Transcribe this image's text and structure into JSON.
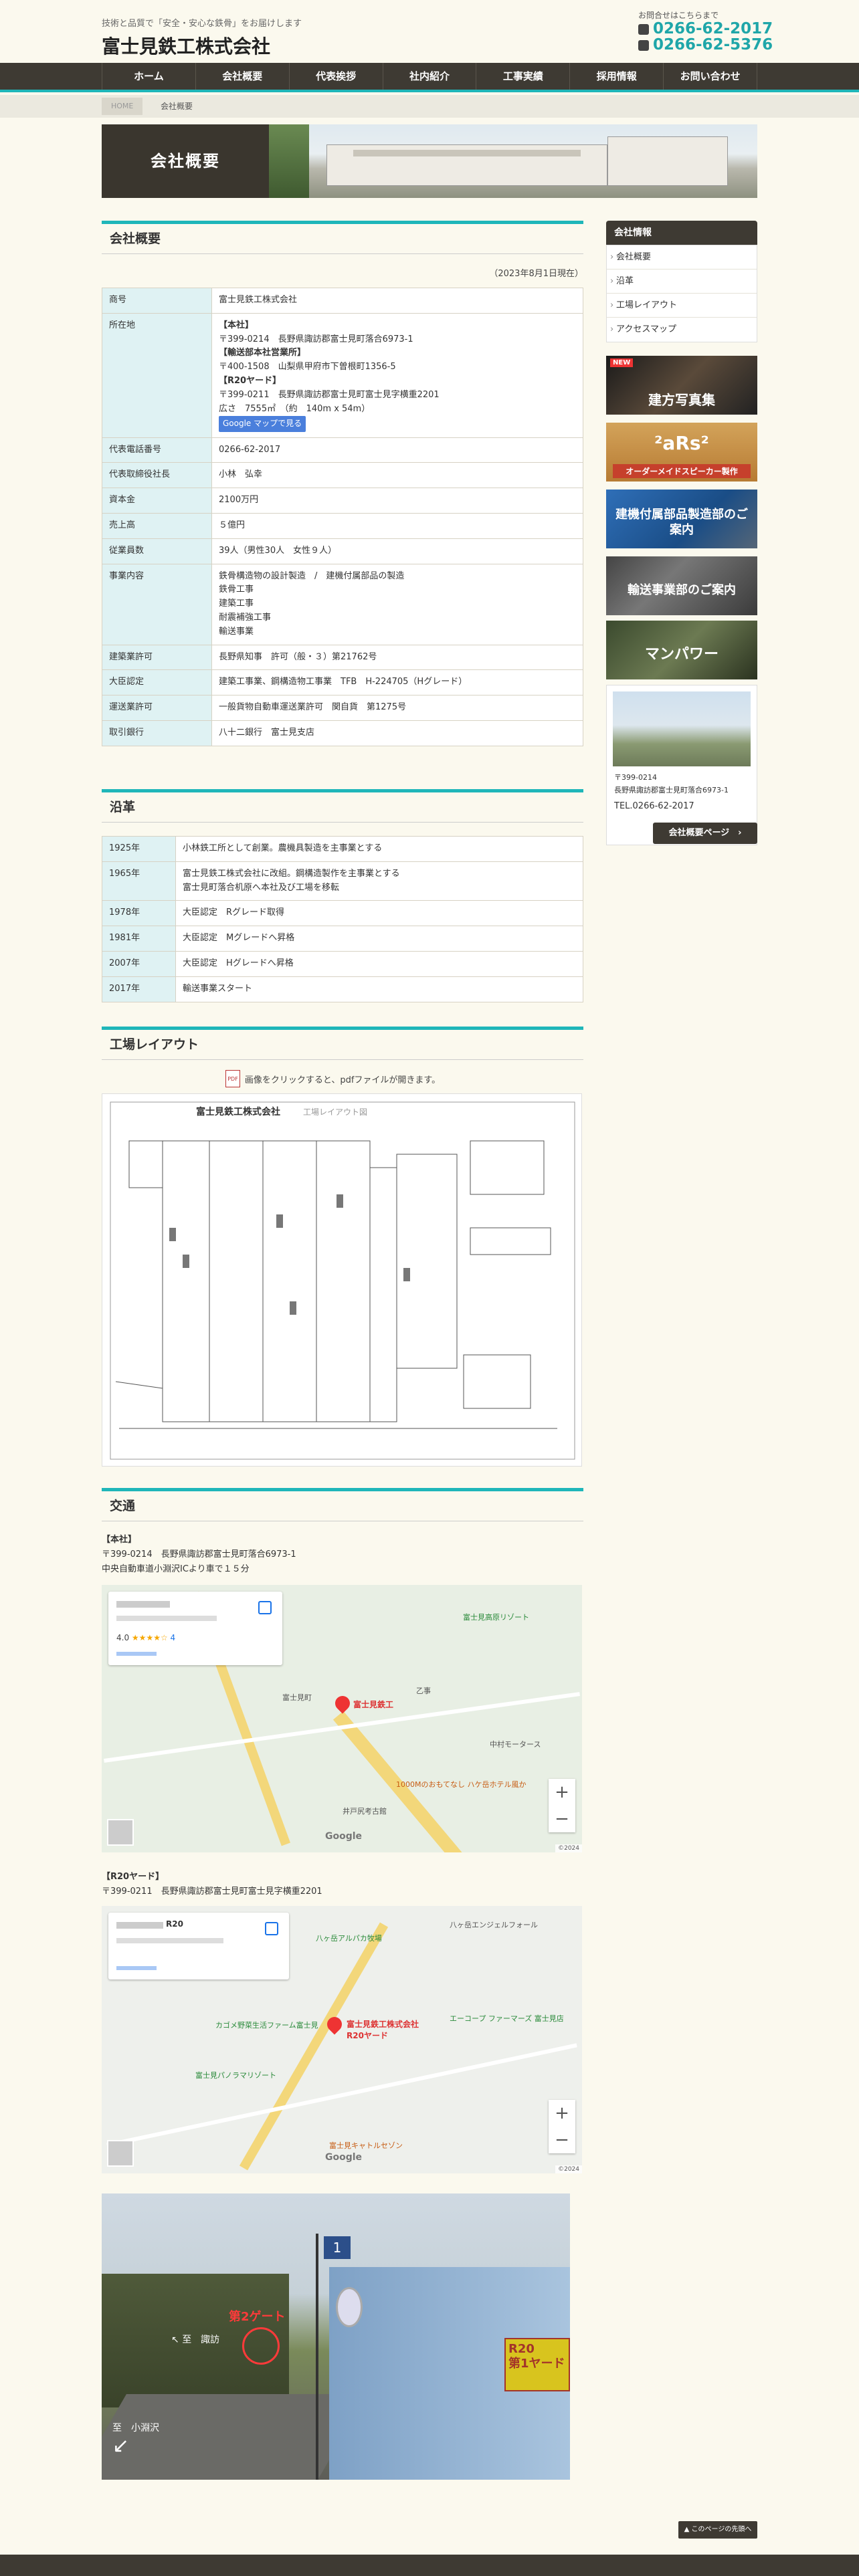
{
  "header": {
    "tagline": "技術と品質で「安全・安心な鉄骨」をお届けします",
    "site_title": "富士見鉄工株式会社",
    "contact_label": "お問合せはこちらまで",
    "tel1": "0266-62-2017",
    "tel2": "0266-62-5376"
  },
  "nav": [
    "ホーム",
    "会社概要",
    "代表挨拶",
    "社内紹介",
    "工事実績",
    "採用情報",
    "お問い合わせ"
  ],
  "breadcrumb": {
    "home": "HOME",
    "current": "会社概要"
  },
  "page_title": "会社概要",
  "overview": {
    "heading": "会社概要",
    "as_of": "（2023年8月1日現在）",
    "rows": [
      {
        "label": "商号",
        "value": "富士見鉄工株式会社"
      },
      {
        "label": "所在地",
        "lines": [
          "【本社】",
          "〒399-0214　長野県諏訪郡富士見町落合6973-1",
          "【輸送部本社営業所】",
          "〒400-1508　山梨県甲府市下曽根町1356-5",
          "【R20ヤード】",
          "〒399-0211　長野県諏訪郡富士見町富士見字横重2201",
          "広さ　7555㎡　（約　140m x 54m）"
        ],
        "button": "Google マップで見る"
      },
      {
        "label": "代表電話番号",
        "value": "0266-62-2017"
      },
      {
        "label": "代表取締役社長",
        "value": "小林　弘幸"
      },
      {
        "label": "資本金",
        "value": "2100万円"
      },
      {
        "label": "売上高",
        "value": "５億円"
      },
      {
        "label": "従業員数",
        "value": "39人（男性30人　女性９人）"
      },
      {
        "label": "事業内容",
        "lines": [
          "鉄骨構造物の設計製造　/　建機付属部品の製造",
          "鉄骨工事",
          "建築工事",
          "耐震補強工事",
          "輸送事業"
        ]
      },
      {
        "label": "建築業許可",
        "value": "長野県知事　許可（般・３）第21762号"
      },
      {
        "label": "大臣認定",
        "value": "建築工事業、鋼構造物工事業　TFB　H-224705（Hグレード）"
      },
      {
        "label": "運送業許可",
        "value": "一般貨物自動車運送業許可　関自貨　第1275号"
      },
      {
        "label": "取引銀行",
        "value": "八十二銀行　富士見支店"
      }
    ]
  },
  "history": {
    "heading": "沿革",
    "rows": [
      {
        "year": "1925年",
        "lines": [
          "小林鉄工所として創業。農機具製造を主事業とする"
        ]
      },
      {
        "year": "1965年",
        "lines": [
          "富士見鉄工株式会社に改組。鋼構造製作を主事業とする",
          "富士見町落合机原へ本社及び工場を移転"
        ]
      },
      {
        "year": "1978年",
        "lines": [
          "大臣認定　Rグレード取得"
        ]
      },
      {
        "year": "1981年",
        "lines": [
          "大臣認定　Mグレードへ昇格"
        ]
      },
      {
        "year": "2007年",
        "lines": [
          "大臣認定　Hグレードへ昇格"
        ]
      },
      {
        "year": "2017年",
        "lines": [
          "輸送事業スタート"
        ]
      }
    ]
  },
  "layout": {
    "heading": "工場レイアウト",
    "note": "画像をクリックすると、pdfファイルが開きます。",
    "pdf_icon": "PDF",
    "drawing_company": "富士見鉄工株式会社",
    "drawing_title": "工場レイアウト図"
  },
  "access": {
    "heading": "交通",
    "hq": {
      "label": "【本社】",
      "address": "〒399-0214　長野県諏訪郡富士見町落合6973-1",
      "directions": "中央自動車道小淵沢ICより車で１５分",
      "map_pin_label": "富士見鉄工",
      "map_places": [
        "富士見町",
        "乙事",
        "富士見高原リゾート",
        "1000Mのおもてなし ハケ岳ホテル風か",
        "井戸尻考古館",
        "中村モータース"
      ],
      "map_rating": "4.0",
      "map_reviews": "4",
      "map_footer": "©2024",
      "map_brand": "Google"
    },
    "r20": {
      "label": "【R20ヤード】",
      "address": "〒399-0211　長野県諏訪郡富士見町富士見字横重2201",
      "map_card_title": "R20",
      "map_pin_label": "富士見鉄工株式会社 R20ヤード",
      "map_places": [
        "八ヶ岳エンジェルフォール",
        "エーコープ ファーマーズ 富士見店",
        "カゴメ野菜生活ファーム富士見",
        "富士見パノラマリゾート",
        "富士見キャトルセゾン",
        "八ヶ岳アルパカ牧場"
      ],
      "map_footer": "©2024",
      "map_brand": "Google"
    },
    "photo": {
      "sign_r20": "R20",
      "sign_yard": "第1ヤード",
      "gate_label": "第2ゲート",
      "dir_left": "至　諏訪",
      "dir_down": "至　小淵沢",
      "route_no": "1"
    }
  },
  "sidebar": {
    "heading": "会社情報",
    "links": [
      "会社概要",
      "沿革",
      "工場レイアウト",
      "アクセスマップ"
    ],
    "banners": [
      "建方写真集",
      "オーダーメイドスピーカー製作",
      "建機付属部品製造部のご案内",
      "輸送事業部のご案内",
      "マンパワー"
    ],
    "banner_badge": "NEW",
    "banner_logo": "²aRs²",
    "address_line1": "〒399-0214",
    "address_line2": "長野県諏訪郡富士見町落合6973-1",
    "tel": "TEL.0266-62-2017",
    "button": "会社概要ページ　›"
  },
  "page_top": "▲ このページの先頭へ"
}
